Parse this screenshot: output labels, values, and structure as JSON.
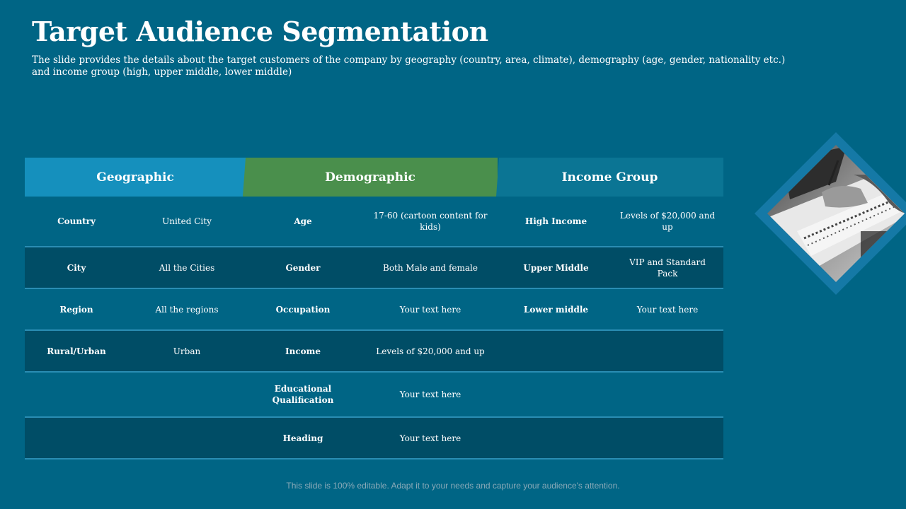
{
  "slide": {
    "title": "Target Audience Segmentation",
    "subtitle": "The slide provides the details about the target customers of the company by geography (country, area, climate), demography (age, gender, nationality etc.) and income group (high, upper middle, lower middle)",
    "footer": "This slide is 100% editable. Adapt it to your needs and capture your audience's attention."
  },
  "colors": {
    "background": "#006585",
    "geographic": "#1590bd",
    "demographic": "#4a8f4c",
    "income": "#0b7594",
    "dark_row": "#004d66"
  },
  "table": {
    "headers": {
      "geographic": "Geographic",
      "demographic": "Demographic",
      "income": "Income Group"
    },
    "rows": [
      [
        "Country",
        "United City",
        "Age",
        "17-60 (cartoon content for kids)",
        "High Income",
        "Levels of $20,000 and up"
      ],
      [
        "City",
        "All the Cities",
        "Gender",
        "Both Male and female",
        "Upper Middle",
        "VIP and Standard  Pack"
      ],
      [
        "Region",
        "All the regions",
        "Occupation",
        "Your text here",
        "Lower middle",
        "Your text here"
      ],
      [
        "Rural/Urban",
        "Urban",
        "Income",
        "Levels of $20,000 and up",
        "",
        ""
      ],
      [
        "",
        "",
        "Educational Qualification",
        "Your text here",
        "",
        ""
      ],
      [
        "",
        "",
        "Heading",
        "Your text here",
        "",
        ""
      ]
    ]
  },
  "image": {
    "icon": "photo-writing-notebook-icon"
  }
}
